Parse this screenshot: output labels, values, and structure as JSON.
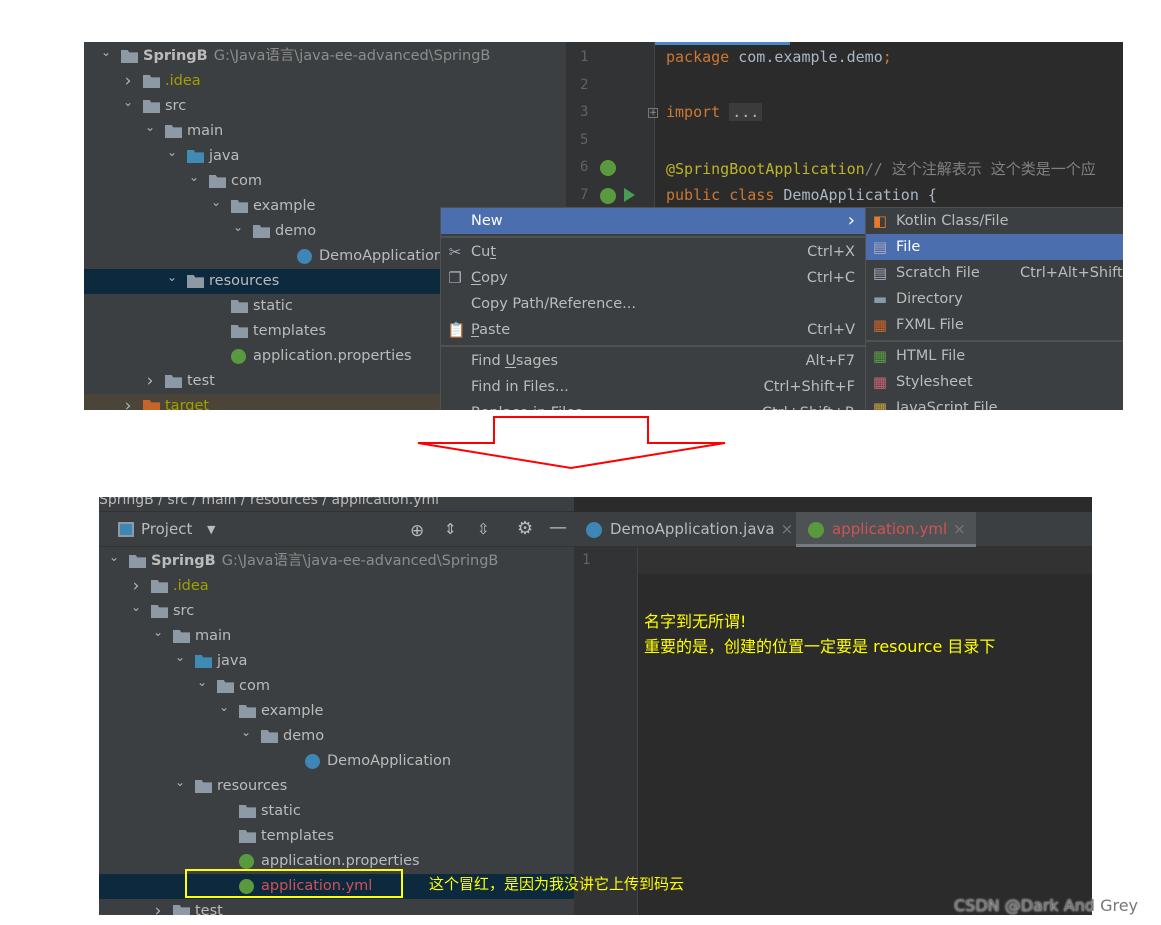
{
  "top": {
    "tree": [
      {
        "label": "SpringB",
        "path": "G:\\Java语言\\java-ee-advanced\\SpringB",
        "depth": 0,
        "chev": "down",
        "icon": "module",
        "bold": true
      },
      {
        "label": ".idea",
        "depth": 1,
        "chev": "right",
        "icon": "folder",
        "color": "#a0a000"
      },
      {
        "label": "src",
        "depth": 1,
        "chev": "down",
        "icon": "folder"
      },
      {
        "label": "main",
        "depth": 2,
        "chev": "down",
        "icon": "folder"
      },
      {
        "label": "java",
        "depth": 3,
        "chev": "down",
        "icon": "folder-blue"
      },
      {
        "label": "com",
        "depth": 4,
        "chev": "down",
        "icon": "package"
      },
      {
        "label": "example",
        "depth": 5,
        "chev": "down",
        "icon": "package"
      },
      {
        "label": "demo",
        "depth": 6,
        "chev": "down",
        "icon": "package"
      },
      {
        "label": "DemoApplication",
        "depth": 8,
        "icon": "spring-java"
      },
      {
        "label": "resources",
        "depth": 3,
        "chev": "down",
        "icon": "folder-res",
        "selected": true
      },
      {
        "label": "static",
        "depth": 5,
        "icon": "folder"
      },
      {
        "label": "templates",
        "depth": 5,
        "icon": "folder"
      },
      {
        "label": "application.properties",
        "depth": 5,
        "icon": "spring"
      },
      {
        "label": "test",
        "depth": 2,
        "chev": "right",
        "icon": "folder"
      },
      {
        "label": "target",
        "depth": 1,
        "chev": "right",
        "icon": "folder-orange",
        "color": "#a0a000",
        "excluded": true
      }
    ],
    "editor": {
      "line_numbers": [
        "1",
        "2",
        "3",
        "5",
        "6",
        "7"
      ],
      "lines": [
        [
          {
            "t": "package ",
            "c": "kw"
          },
          {
            "t": "com.example.demo"
          },
          {
            "t": ";",
            "c": "kw"
          }
        ],
        [],
        [
          {
            "t": "import ",
            "c": "kw"
          },
          {
            "t": "..."
          }
        ],
        [],
        [
          {
            "t": "@SpringBootApplication",
            "c": "ann"
          },
          {
            "t": "// 这个注解表示 这个类是一个应",
            "c": "cm"
          }
        ],
        [
          {
            "t": "public class ",
            "c": "kw"
          },
          {
            "t": "DemoApplication {"
          }
        ]
      ]
    },
    "context_menu": [
      {
        "label": "New",
        "highlight": true,
        "submenu": true
      },
      {
        "sep": true
      },
      {
        "label": "Cut",
        "underline": "t",
        "shortcut": "Ctrl+X",
        "icon": "scissors-icon"
      },
      {
        "label": "Copy",
        "underline": "C",
        "shortcut": "Ctrl+C",
        "icon": "copy-icon"
      },
      {
        "label": "Copy Path/Reference..."
      },
      {
        "label": "Paste",
        "underline": "P",
        "shortcut": "Ctrl+V",
        "icon": "clipboard-icon"
      },
      {
        "sep": true
      },
      {
        "label": "Find Usages",
        "underline": "U",
        "shortcut": "Alt+F7"
      },
      {
        "label": "Find in Files...",
        "shortcut": "Ctrl+Shift+F"
      },
      {
        "label": "Replace in Files...",
        "shortcut": "Ctrl+Shift+R"
      }
    ],
    "submenu": [
      {
        "label": "Kotlin Class/File",
        "icon": "kotlin-icon"
      },
      {
        "label": "File",
        "highlight": true,
        "icon": "file-icon"
      },
      {
        "label": "Scratch File",
        "shortcut": "Ctrl+Alt+Shift+Insert",
        "icon": "scratch-file-icon"
      },
      {
        "label": "Directory",
        "icon": "folder-icon"
      },
      {
        "label": "FXML File",
        "icon": "fxml-icon"
      },
      {
        "sep": true
      },
      {
        "label": "HTML File",
        "icon": "html-icon"
      },
      {
        "label": "Stylesheet",
        "icon": "css-icon"
      },
      {
        "label": "JavaScript File",
        "icon": "js-icon"
      }
    ]
  },
  "bottom": {
    "breadcrumb": "SpringB / src / main / resources / application.yml",
    "project_label": "Project",
    "tabs": [
      {
        "label": "DemoApplication.java",
        "color": "#bbbbbb",
        "icon": "spring-java"
      },
      {
        "label": "application.yml",
        "color": "#d25252",
        "icon": "spring",
        "active": true
      }
    ],
    "tree": [
      {
        "label": "SpringB",
        "path": "G:\\Java语言\\java-ee-advanced\\SpringB",
        "depth": 0,
        "chev": "down",
        "icon": "module",
        "bold": true
      },
      {
        "label": ".idea",
        "depth": 1,
        "chev": "right",
        "icon": "folder",
        "color": "#a0a000"
      },
      {
        "label": "src",
        "depth": 1,
        "chev": "down",
        "icon": "folder"
      },
      {
        "label": "main",
        "depth": 2,
        "chev": "down",
        "icon": "folder"
      },
      {
        "label": "java",
        "depth": 3,
        "chev": "down",
        "icon": "folder-blue"
      },
      {
        "label": "com",
        "depth": 4,
        "chev": "down",
        "icon": "package"
      },
      {
        "label": "example",
        "depth": 5,
        "chev": "down",
        "icon": "package"
      },
      {
        "label": "demo",
        "depth": 6,
        "chev": "down",
        "icon": "package"
      },
      {
        "label": "DemoApplication",
        "depth": 8,
        "icon": "spring-java"
      },
      {
        "label": "resources",
        "depth": 3,
        "chev": "down",
        "icon": "folder-res"
      },
      {
        "label": "static",
        "depth": 5,
        "icon": "folder"
      },
      {
        "label": "templates",
        "depth": 5,
        "icon": "folder"
      },
      {
        "label": "application.properties",
        "depth": 5,
        "icon": "spring"
      },
      {
        "label": "application.yml",
        "depth": 5,
        "icon": "spring",
        "color": "#d25252",
        "selected": true
      },
      {
        "label": "test",
        "depth": 2,
        "chev": "right",
        "icon": "folder"
      }
    ],
    "line_number": "1",
    "note_line1": "名字到无所谓!",
    "note_line2": "重要的是，创建的位置一定要是 resource 目录下",
    "note_red": "这个冒红，是因为我没讲它上传到码云"
  },
  "watermark": "CSDN @Dark And Grey",
  "colors": {
    "accent": "#4b6eaf",
    "annotation": "#ffff00",
    "arrow": "#ff0000",
    "highlight_box": "#ffff00",
    "vcs_unversioned": "#d25252"
  }
}
